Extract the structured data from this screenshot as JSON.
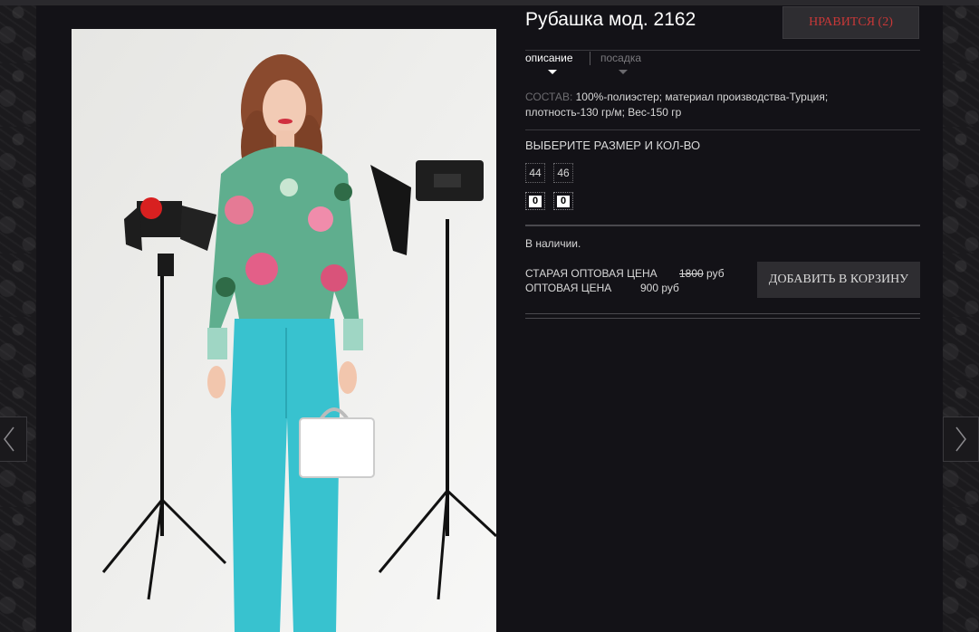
{
  "product": {
    "title": "Рубашка мод. 2162",
    "like_label": "НРАВИТСЯ (2)",
    "tabs": [
      {
        "label": "описание"
      },
      {
        "label": "посадка"
      }
    ],
    "composition_label": "СОСТАВ:",
    "composition_text": "100%-полиэстер; материал производства-Турция;",
    "composition_text2": "плотность-130 гр/м; Вес-150 гр",
    "size_title": "ВЫБЕРИТЕ РАЗМЕР И КОЛ-ВО",
    "sizes": [
      {
        "size": "44",
        "qty": "0"
      },
      {
        "size": "46",
        "qty": "0"
      }
    ],
    "stock": "В наличии.",
    "old_price_label": "СТАРАЯ ОПТОВАЯ ЦЕНА",
    "old_price_value": "1800",
    "old_price_unit": "руб",
    "price_label": "ОПТОВАЯ ЦЕНА",
    "price_value": "900 руб",
    "add_to_cart": "ДОБАВИТЬ В КОРЗИНУ"
  },
  "colors": {
    "background": "#131217",
    "accent_like": "#c83838",
    "button_bg": "#2e2d31",
    "text": "#d8d8d8"
  },
  "icons": {
    "prev": "chevron-left-icon",
    "next": "chevron-right-icon",
    "tab_indicator": "triangle-down-icon"
  }
}
